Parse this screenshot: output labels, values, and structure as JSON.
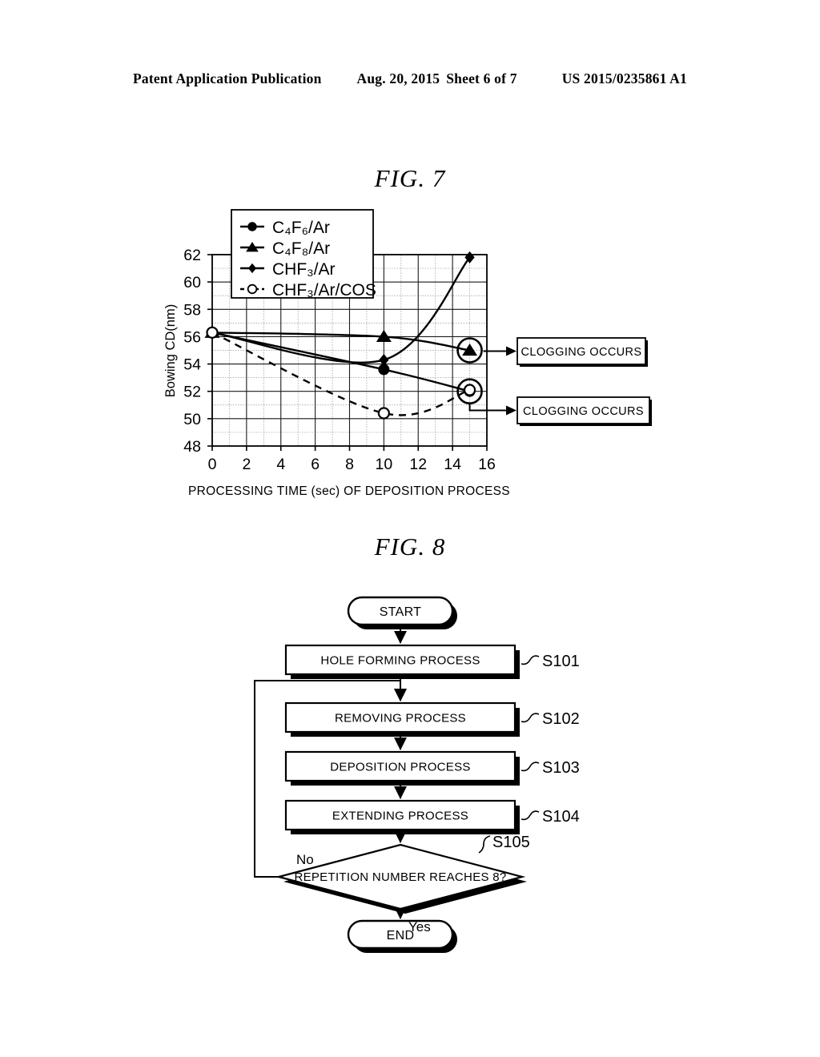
{
  "header": {
    "publication": "Patent Application Publication",
    "date": "Aug. 20, 2015",
    "sheet": "Sheet 6 of 7",
    "docnum": "US 2015/0235861 A1"
  },
  "figures": {
    "fig7_title": "FIG. 7",
    "fig8_title": "FIG. 8"
  },
  "chart_data": {
    "type": "line",
    "title": "FIG. 7",
    "xlabel": "PROCESSING TIME (sec) OF DEPOSITION PROCESS",
    "ylabel": "Bowing CD(nm)",
    "xlim": [
      0,
      16
    ],
    "ylim": [
      48,
      62
    ],
    "xticks": [
      "0",
      "2",
      "4",
      "6",
      "8",
      "10",
      "12",
      "14",
      "16"
    ],
    "yticks": [
      "48",
      "50",
      "52",
      "54",
      "56",
      "58",
      "60",
      "62"
    ],
    "grid": true,
    "legend_position": "top-left-inside",
    "series": [
      {
        "name": "C₄F₆/Ar",
        "marker": "filled-circle",
        "linestyle": "solid",
        "x": [
          0,
          10,
          15
        ],
        "y": [
          56.3,
          53.6,
          52.0
        ]
      },
      {
        "name": "C₄F₈/Ar",
        "marker": "filled-triangle",
        "linestyle": "solid",
        "x": [
          0,
          10,
          15
        ],
        "y": [
          56.3,
          56.0,
          55.0
        ]
      },
      {
        "name": "CHF₃/Ar",
        "marker": "filled-diamond",
        "linestyle": "solid",
        "x": [
          0,
          10,
          15
        ],
        "y": [
          56.3,
          54.3,
          61.8
        ]
      },
      {
        "name": "CHF₃/Ar/COS",
        "marker": "open-circle",
        "linestyle": "dashed",
        "x": [
          0,
          10,
          15
        ],
        "y": [
          56.3,
          50.4,
          52.1
        ]
      }
    ],
    "annotations": [
      {
        "label": "CLOGGING OCCURS",
        "points_to_series": "C₄F₈/Ar",
        "at_x": 15,
        "at_y": 55.0
      },
      {
        "label": "CLOGGING OCCURS",
        "points_to_series": "C₄F₆/Ar",
        "at_x": 15,
        "at_y": 52.0
      }
    ]
  },
  "flowchart": {
    "start_label": "START",
    "end_label": "END",
    "yes_label": "Yes",
    "no_label": "No",
    "steps": [
      {
        "label": "HOLE FORMING PROCESS",
        "tag": "S101"
      },
      {
        "label": "REMOVING PROCESS",
        "tag": "S102"
      },
      {
        "label": "DEPOSITION PROCESS",
        "tag": "S103"
      },
      {
        "label": "EXTENDING PROCESS",
        "tag": "S104"
      }
    ],
    "decision": {
      "label": "REPETITION NUMBER REACHES 8?",
      "tag": "S105"
    }
  }
}
